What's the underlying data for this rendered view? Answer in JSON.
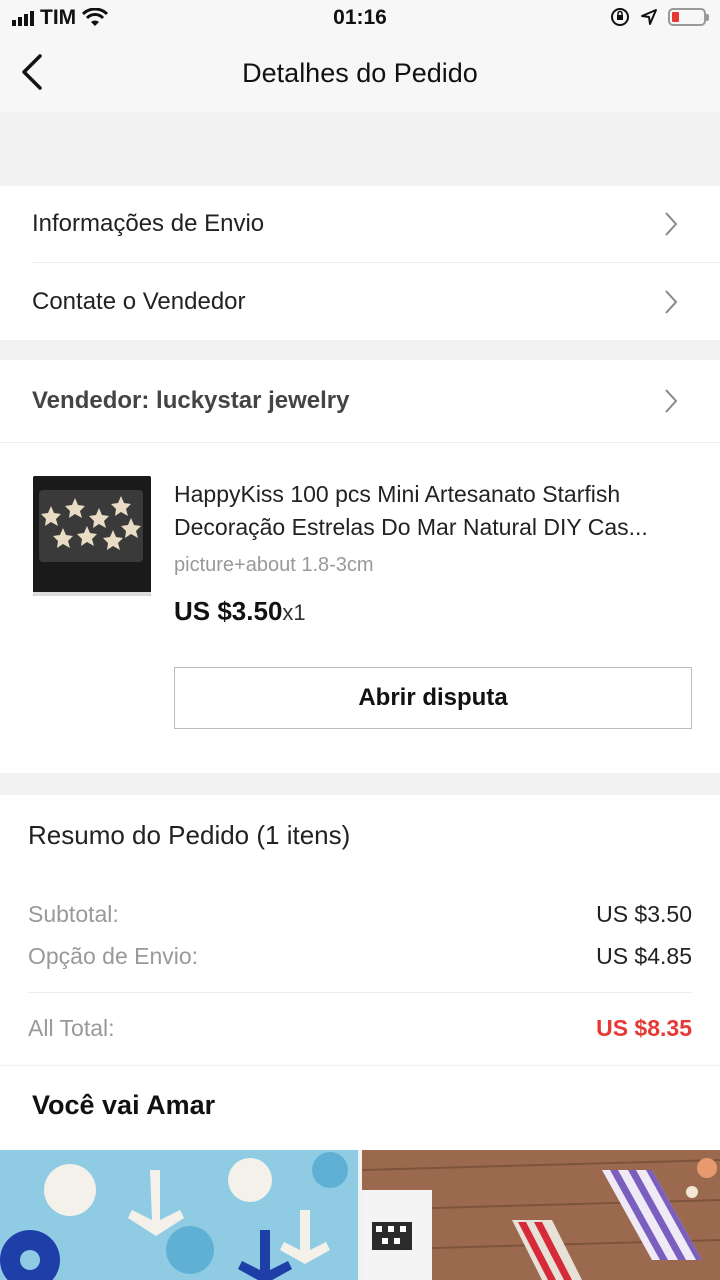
{
  "status_bar": {
    "carrier": "TIM",
    "time": "01:16"
  },
  "nav": {
    "title": "Detalhes do Pedido"
  },
  "links": {
    "shipping": "Informações de Envio",
    "contact": "Contate o Vendedor"
  },
  "seller": {
    "label": "Vendedor: luckystar jewelry"
  },
  "product": {
    "name_line1": "HappyKiss 100 pcs Mini Artesanato Starfish",
    "name_line2": "Decoração Estrelas Do Mar Natural DIY Cas...",
    "sku": "picture+about 1.8-3cm",
    "price": "US $3.50",
    "qty": "x1",
    "dispute_label": "Abrir disputa"
  },
  "summary": {
    "title": "Resumo do Pedido (1 itens)",
    "subtotal_label": "Subtotal:",
    "subtotal_value": "US $3.50",
    "shipping_label": "Opção de Envio:",
    "shipping_value": "US $4.85",
    "total_label": "All Total:",
    "total_value": "US $8.35"
  },
  "recommend": {
    "title": "Você vai Amar"
  },
  "colors": {
    "accent_red": "#e53935",
    "background": "#f2f2f2"
  },
  "icons": [
    "signal-icon",
    "wifi-icon",
    "lock-rotation-icon",
    "location-icon",
    "battery-icon",
    "back-icon",
    "chevron-right-icon"
  ]
}
